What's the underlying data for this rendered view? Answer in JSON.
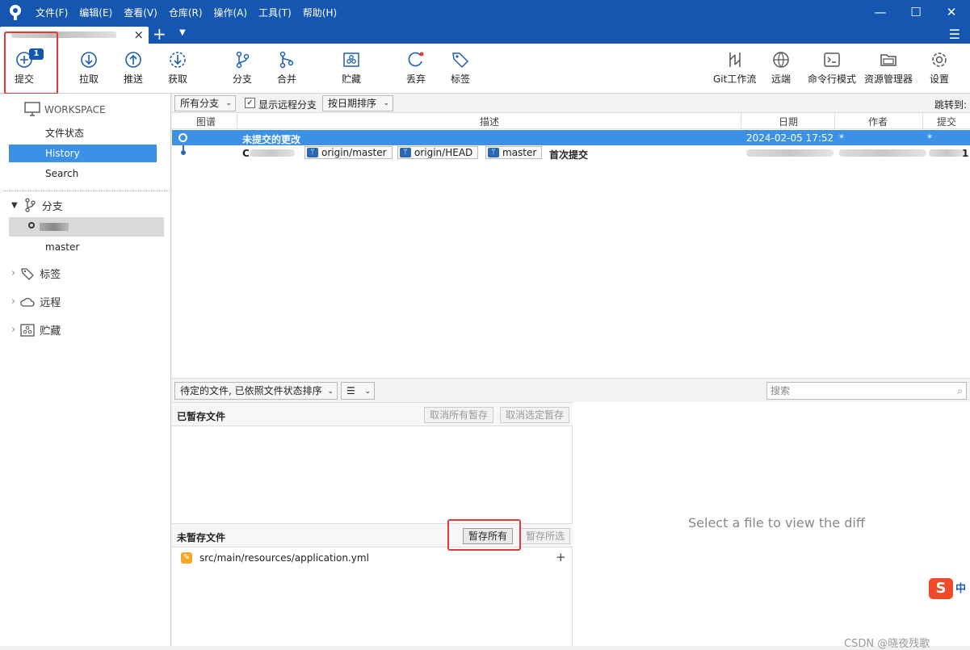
{
  "menubar": {
    "items": [
      "文件(F)",
      "编辑(E)",
      "查看(V)",
      "仓库(R)",
      "操作(A)",
      "工具(T)",
      "帮助(H)"
    ]
  },
  "window": {
    "minimize": "—",
    "maximize": "☐",
    "close": "✕"
  },
  "toolbar": {
    "commit": "提交",
    "commit_badge": "1",
    "pull": "拉取",
    "push": "推送",
    "fetch": "获取",
    "branch": "分支",
    "merge": "合并",
    "stash": "贮藏",
    "discard": "丢弃",
    "tag": "标签",
    "gitflow": "Git工作流",
    "remote": "远端",
    "terminal": "命令行模式",
    "explorer": "资源管理器",
    "settings": "设置"
  },
  "sidebar": {
    "workspace": "WORKSPACE",
    "items": [
      "文件状态",
      "History",
      "Search"
    ],
    "branches_label": "分支",
    "branches": [
      "master"
    ],
    "tags_label": "标签",
    "remotes_label": "远程",
    "stashes_label": "贮藏"
  },
  "filterbar": {
    "branch_filter": "所有分支",
    "show_remote": "显示远程分支",
    "sort": "按日期排序",
    "jump": "跳转到:"
  },
  "log": {
    "columns": [
      "图谱",
      "描述",
      "日期",
      "作者",
      "提交"
    ],
    "rows": [
      {
        "desc": "未提交的更改",
        "date": "2024-02-05 17:52",
        "author": "*",
        "commit": "*"
      },
      {
        "prefix": "C",
        "refs": [
          "origin/master",
          "origin/HEAD",
          "master"
        ],
        "desc": "首次提交",
        "commit": "1"
      }
    ]
  },
  "files": {
    "sort_label": "待定的文件, 已依照文件状态排序",
    "search_placeholder": "搜索",
    "staged_title": "已暂存文件",
    "unstage_all": "取消所有暂存",
    "unstage_selected": "取消选定暂存",
    "unstaged_title": "未暂存文件",
    "stage_all": "暂存所有",
    "stage_selected": "暂存所选",
    "unstaged": [
      {
        "path": "src/main/resources/application.yml"
      }
    ]
  },
  "diff": {
    "placeholder": "Select a file to view the diff"
  },
  "watermark": "CSDN @晓夜残歌",
  "colors": {
    "accent": "#1557b0",
    "selection": "#3c91e6",
    "highlight": "#e53935"
  }
}
